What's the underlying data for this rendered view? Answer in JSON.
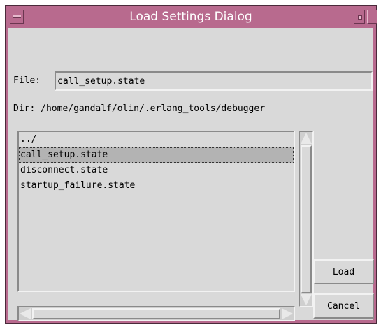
{
  "window": {
    "title": "Load Settings Dialog"
  },
  "file": {
    "label": "File:",
    "value": "call_setup.state"
  },
  "dir": {
    "label": "Dir: /home/gandalf/olin/.erlang_tools/debugger"
  },
  "file_list": {
    "items": [
      "../",
      "call_setup.state",
      "disconnect.state",
      "startup_failure.state"
    ],
    "selected_index": 1
  },
  "buttons": {
    "load": "Load",
    "cancel": "Cancel"
  },
  "colors": {
    "titlebar": "#b86a8e",
    "background": "#d9d9d9",
    "selection": "#b3b3b3"
  }
}
